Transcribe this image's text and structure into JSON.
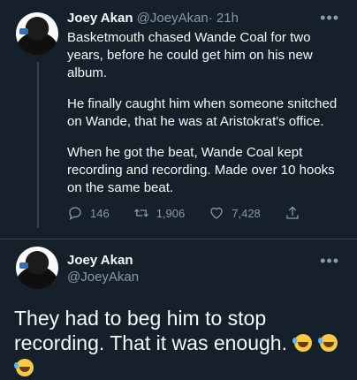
{
  "tweet1": {
    "name": "Joey Akan",
    "handle": "@JoeyAkan",
    "time": "· 21h",
    "paragraphs": [
      "Basketmouth chased Wande Coal for two years, before he could get him on his new album.",
      "He finally caught him when someone snitched on Wande, that he was at Aristokrat's office.",
      "When he got the beat, Wande Coal kept recording and recording. Made over 10 hooks on the same beat."
    ],
    "replies": "146",
    "retweets": "1,906",
    "likes": "7,428"
  },
  "tweet2": {
    "name": "Joey Akan",
    "handle": "@JoeyAkan",
    "text": "They had to beg him to stop recording. That it was enough.",
    "emoji_names": [
      "face-with-tears-of-joy",
      "face-with-tears-of-joy",
      "face-with-tears-of-joy"
    ]
  },
  "icons": {
    "more": "more-horizontal-icon",
    "reply": "reply-icon",
    "retweet": "retweet-icon",
    "like": "heart-icon",
    "share": "share-icon"
  },
  "colors": {
    "background": "#15202b",
    "text": "#f7f9f9",
    "muted": "#8b98a5",
    "divider": "#38444d"
  }
}
